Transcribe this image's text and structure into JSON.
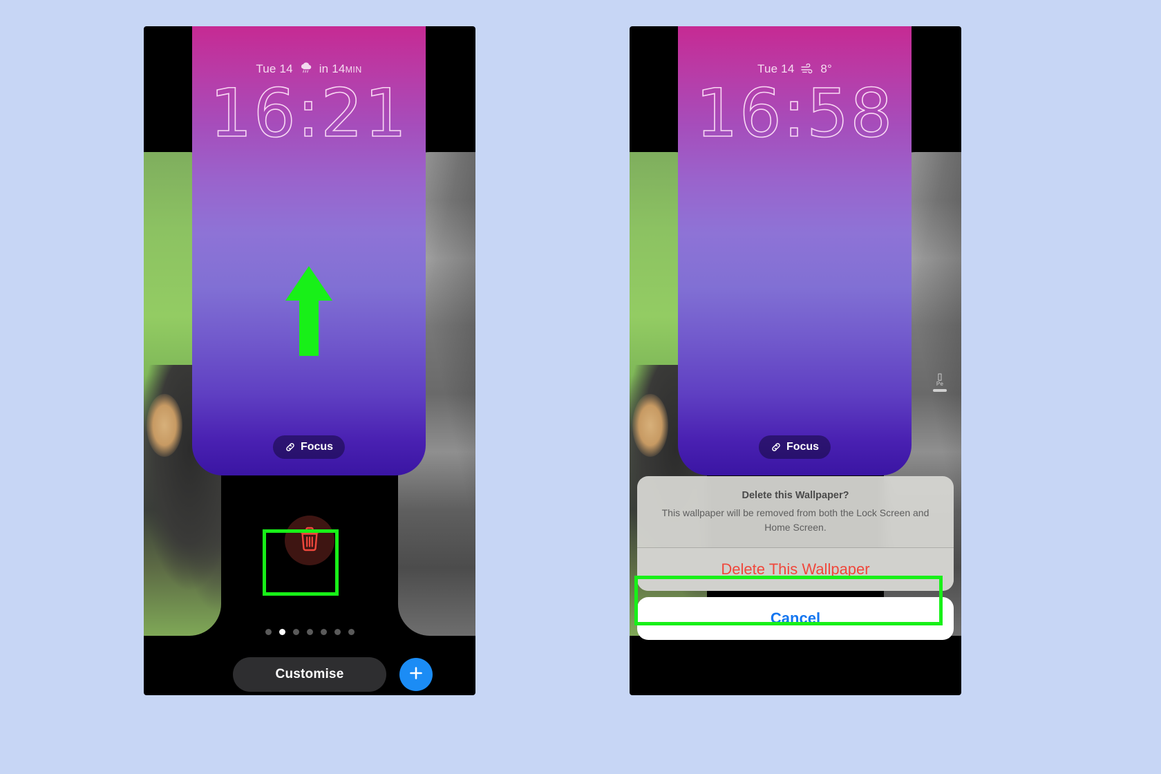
{
  "background_color": "#c7d6f5",
  "accent": {
    "highlight_green": "#18f018",
    "destructive_red": "#f0483c",
    "link_blue": "#1476f0",
    "plus_blue": "#1b8cf5",
    "trash_red": "#f0483c"
  },
  "left_phone": {
    "lock_screen": {
      "date": "Tue 14",
      "weather_icon": "rain-cloud-icon",
      "weather_text": "in 14",
      "weather_unit": "MIN",
      "time": "16:21",
      "focus_icon": "link-icon",
      "focus_label": "Focus"
    },
    "trash_button": {
      "icon": "trash-icon",
      "highlighted": true
    },
    "arrow_annotation": "arrow-up-icon",
    "page_dots": {
      "count": 7,
      "active_index": 1
    },
    "customise_label": "Customise",
    "add_button_icon": "plus-icon"
  },
  "right_phone": {
    "lock_screen": {
      "date": "Tue 14",
      "weather_icon": "wind-icon",
      "weather_text": "8°",
      "time": "16:58",
      "focus_icon": "link-icon",
      "focus_label": "Focus"
    },
    "mini_widget": {
      "glyph": "phone-icon",
      "label": "Pe"
    },
    "action_sheet": {
      "title": "Delete this Wallpaper?",
      "message": "This wallpaper will be removed from both the Lock Screen and Home Screen.",
      "destructive_label": "Delete This Wallpaper",
      "destructive_highlighted": true,
      "cancel_label": "Cancel"
    }
  }
}
